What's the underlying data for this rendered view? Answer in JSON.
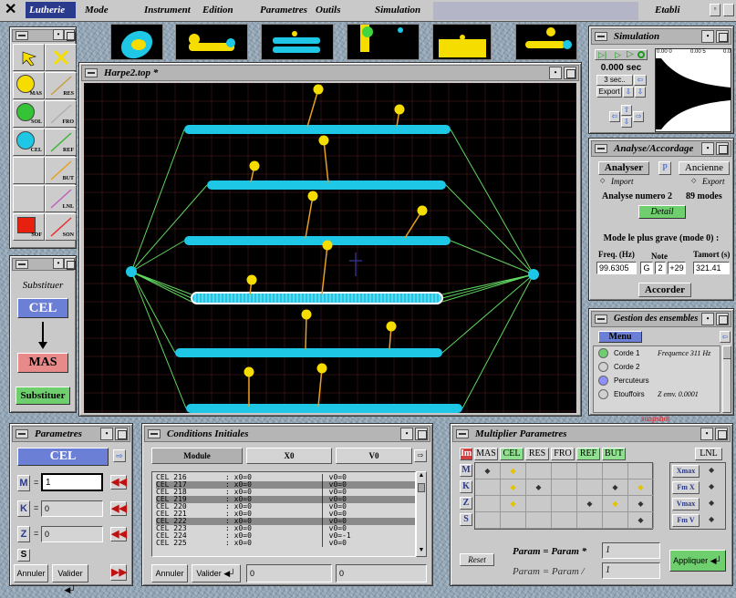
{
  "menubar": {
    "items": [
      "Lutherie",
      "Mode",
      "Instrument",
      "Edition",
      "Parametres",
      "Outils",
      "Simulation"
    ],
    "right": "Etabli"
  },
  "canvas": {
    "title": "Harpe2.top *"
  },
  "tools": [
    {
      "label": "",
      "kind": "cursor"
    },
    {
      "label": "",
      "kind": "delete"
    },
    {
      "label": "MAS",
      "kind": "mas"
    },
    {
      "label": "RES",
      "kind": "res"
    },
    {
      "label": "SOL",
      "kind": "sol"
    },
    {
      "label": "FRO",
      "kind": "fro"
    },
    {
      "label": "CEL",
      "kind": "cel"
    },
    {
      "label": "REF",
      "kind": "ref"
    },
    {
      "label": "",
      "kind": "empty"
    },
    {
      "label": "BUT",
      "kind": "but"
    },
    {
      "label": "",
      "kind": "empty"
    },
    {
      "label": "LNL",
      "kind": "lnl"
    },
    {
      "label": "SOF",
      "kind": "sof"
    },
    {
      "label": "SON",
      "kind": "son"
    }
  ],
  "substitute": {
    "title": "Substituer",
    "from": "CEL",
    "to": "MAS",
    "button": "Substituer"
  },
  "parametres": {
    "title": "Parametres",
    "type": "CEL",
    "fields": [
      {
        "key": "M",
        "value": "1"
      },
      {
        "key": "K",
        "value": "0"
      },
      {
        "key": "Z",
        "value": "0"
      }
    ],
    "s_label": "S",
    "cancel": "Annuler",
    "validate": "Valider"
  },
  "conditions": {
    "title": "Conditions Initiales",
    "headers": [
      "Module",
      "X0",
      "V0"
    ],
    "rows": [
      {
        "name": "CEL 216",
        "x": ": x0=0",
        "v": "| v0=0",
        "sel": false
      },
      {
        "name": "CEL 217",
        "x": ": x0=0",
        "v": "| v0=0",
        "sel": true
      },
      {
        "name": "CEL 218",
        "x": ": x0=0",
        "v": "| v0=0",
        "sel": false
      },
      {
        "name": "CEL 219",
        "x": ": x0=0",
        "v": "| v0=0",
        "sel": true
      },
      {
        "name": "CEL 220",
        "x": ": x0=0",
        "v": "| v0=0",
        "sel": false
      },
      {
        "name": "CEL 221",
        "x": ": x0=0",
        "v": "| v0=0",
        "sel": false
      },
      {
        "name": "CEL 222",
        "x": ": x0=0",
        "v": "| v0=0",
        "sel": true
      },
      {
        "name": "CEL 223",
        "x": ": x0=0",
        "v": "| v0=0",
        "sel": false
      },
      {
        "name": "CEL 224",
        "x": ": x0=0",
        "v": "| v0=-1",
        "sel": false
      },
      {
        "name": "CEL 225",
        "x": ": x0=0",
        "v": "| v0=0",
        "sel": false
      }
    ],
    "cancel": "Annuler",
    "validate": "Valider",
    "x_value": "0",
    "v_value": "0"
  },
  "multiplier": {
    "title": "Multiplier Parametres",
    "cols": [
      "Im",
      "MAS",
      "CEL",
      "RES",
      "FRO",
      "REF",
      "BUT"
    ],
    "rows": [
      "M",
      "K",
      "Z",
      "S"
    ],
    "right_col": "LNL",
    "right_rows": [
      "Xmax",
      "Fm X",
      "Vmax",
      "Fm V"
    ],
    "reset": "Reset",
    "formula1": "Param = Param *",
    "formula2": "Param = Param /",
    "value1": "1",
    "value2": "1",
    "apply": "Appliquer"
  },
  "simulation": {
    "title": "Simulation",
    "time": "0.000 sec",
    "step": "3 sec..",
    "export": "Export",
    "ticks": [
      "0.00 0",
      "0.00 5",
      "0.0"
    ]
  },
  "analyse": {
    "title": "Analyse/Accordage",
    "analyze": "Analyser",
    "p": "P",
    "previous": "Ancienne",
    "import": "Import",
    "export": "Export",
    "number_label": "Analyse numero 2",
    "modes": "89 modes",
    "detail": "Detail",
    "lowest": "Mode le plus grave (mode 0) :",
    "freq_label": "Freq. (Hz)",
    "note_label": "Note",
    "tamort_label": "Tamort (s)",
    "freq": "99.6305",
    "note": "G",
    "octave": "2",
    "cents": "+29",
    "tamort": "321.41",
    "tune": "Accorder"
  },
  "ensembles": {
    "title": "Gestion des ensembles",
    "menu": "Menu",
    "items": [
      {
        "name": "Corde 1",
        "info": "Frequence 311 Hz",
        "color": "#6fcf6f"
      },
      {
        "name": "Corde 2",
        "info": "",
        "color": "#d0d0d0"
      },
      {
        "name": "Percuteurs",
        "info": "",
        "color": "#8f8fff"
      },
      {
        "name": "Etouffoirs",
        "info": "Z emv. 0.0001",
        "color": "#d0d0d0"
      }
    ],
    "snapshot": "snapshot"
  }
}
